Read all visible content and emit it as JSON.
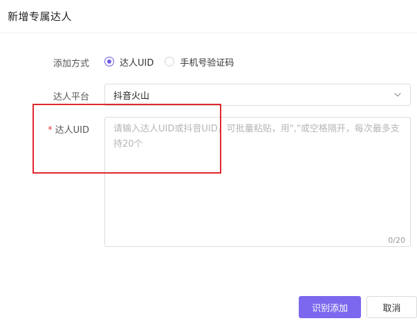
{
  "dialog": {
    "title": "新增专属达人"
  },
  "form": {
    "add_method": {
      "label": "添加方式",
      "options": [
        {
          "label": "达人UID",
          "checked": true
        },
        {
          "label": "手机号验证码",
          "checked": false
        }
      ]
    },
    "platform": {
      "label": "达人平台",
      "selected": "抖音火山",
      "icon": "chevron-down-icon"
    },
    "uid": {
      "required_mark": "*",
      "label": "达人UID",
      "placeholder": "请输入达人UID或抖音UID，可批量粘贴，用\",\"或空格隔开，每次最多支持20个",
      "value": "",
      "counter": "0/20"
    }
  },
  "footer": {
    "submit_label": "识别添加",
    "cancel_label": "取消"
  },
  "colors": {
    "accent": "#7b68ee",
    "required": "#e53935",
    "highlight": "#e0262b"
  }
}
